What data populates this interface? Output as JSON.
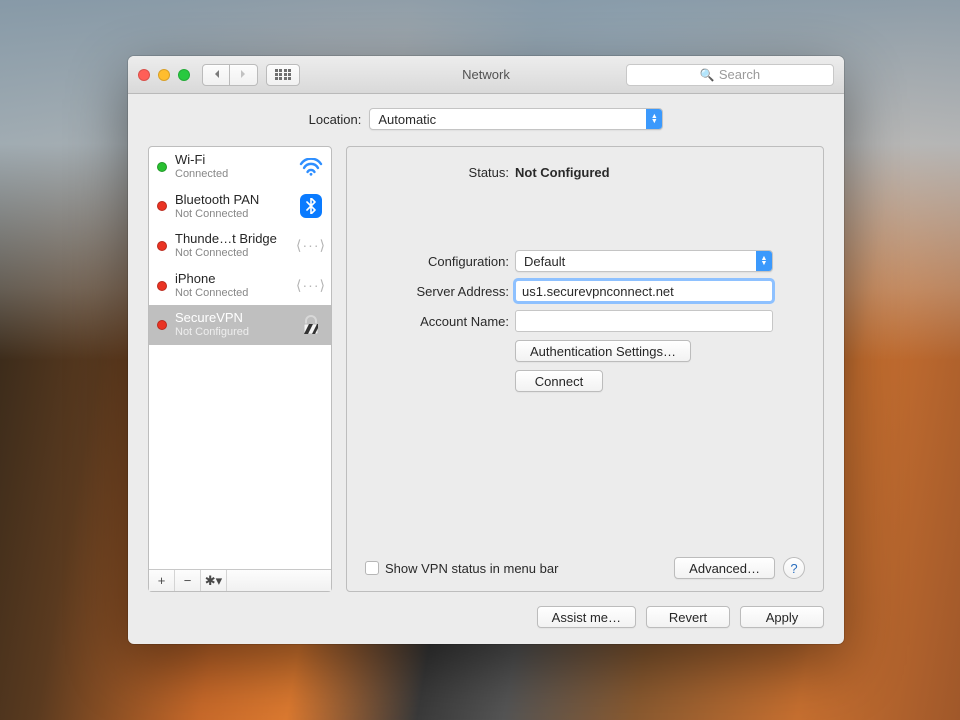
{
  "window": {
    "title": "Network"
  },
  "toolbar": {
    "search_placeholder": "Search"
  },
  "location": {
    "label": "Location:",
    "value": "Automatic"
  },
  "sidebar": {
    "items": [
      {
        "name": "Wi-Fi",
        "sub": "Connected",
        "status": "green",
        "icon": "wifi"
      },
      {
        "name": "Bluetooth PAN",
        "sub": "Not Connected",
        "status": "red",
        "icon": "bluetooth"
      },
      {
        "name": "Thunde…t Bridge",
        "sub": "Not Connected",
        "status": "red",
        "icon": "thunderbolt"
      },
      {
        "name": "iPhone",
        "sub": "Not Connected",
        "status": "red",
        "icon": "thunderbolt"
      },
      {
        "name": "SecureVPN",
        "sub": "Not Configured",
        "status": "red",
        "icon": "lock"
      }
    ]
  },
  "detail": {
    "status_label": "Status:",
    "status_value": "Not Configured",
    "config_label": "Configuration:",
    "config_value": "Default",
    "server_label": "Server Address:",
    "server_value": "us1.securevpnconnect.net",
    "account_label": "Account Name:",
    "account_value": "",
    "auth_button": "Authentication Settings…",
    "connect_button": "Connect",
    "menubar_checkbox": "Show VPN status in menu bar",
    "advanced_button": "Advanced…"
  },
  "footer": {
    "assist": "Assist me…",
    "revert": "Revert",
    "apply": "Apply"
  }
}
